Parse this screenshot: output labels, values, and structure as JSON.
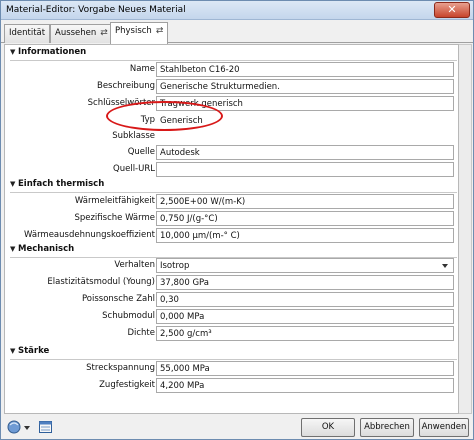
{
  "window": {
    "title": "Material-Editor: Vorgabe Neues Material",
    "close_label": "✕"
  },
  "tabs": [
    {
      "label": "Identität"
    },
    {
      "label": "Aussehen",
      "swap_icon": "⇄"
    },
    {
      "label": "Physisch",
      "swap_icon": "⇄"
    }
  ],
  "sections": {
    "informationen": {
      "title": "Informationen",
      "fields": [
        {
          "label": "Name",
          "value": "Stahlbeton C16-20"
        },
        {
          "label": "Beschreibung",
          "value": "Generische Strukturmedien."
        },
        {
          "label": "Schlüsselwörter",
          "value": "Tragwerk generisch"
        },
        {
          "label": "Typ",
          "value": "Generisch"
        },
        {
          "label": "Subklasse",
          "value": ""
        },
        {
          "label": "Quelle",
          "value": "Autodesk"
        },
        {
          "label": "Quell-URL",
          "value": ""
        }
      ]
    },
    "thermisch": {
      "title": "Einfach thermisch",
      "fields": [
        {
          "label": "Wärmeleitfähigkeit",
          "value": "2,500E+00 W/(m-K)"
        },
        {
          "label": "Spezifische Wärme",
          "value": "0,750 J/(g-°C)"
        },
        {
          "label": "Wärmeausdehnungskoeffizient",
          "value": "10,000 µm/(m-° C)"
        }
      ]
    },
    "mechanisch": {
      "title": "Mechanisch",
      "fields": [
        {
          "label": "Verhalten",
          "value": "Isotrop"
        },
        {
          "label": "Elastizitätsmodul (Young)",
          "value": "37,800 GPa"
        },
        {
          "label": "Poissonsche Zahl",
          "value": "0,30"
        },
        {
          "label": "Schubmodul",
          "value": "0,000 MPa"
        },
        {
          "label": "Dichte",
          "value": "2,500 g/cm³"
        }
      ]
    },
    "staerke": {
      "title": "Stärke",
      "fields": [
        {
          "label": "Streckspannung",
          "value": "55,000 MPa"
        },
        {
          "label": "Zugfestigkeit",
          "value": "4,200 MPa"
        }
      ]
    }
  },
  "buttons": {
    "ok": "OK",
    "cancel": "Abbrechen",
    "apply": "Anwenden"
  },
  "icons": {
    "section_toggle": "triangle-down-icon",
    "material_browser": "material-browser-icon",
    "asset_browser": "asset-browser-icon"
  },
  "colors": {
    "annotation": "#d81818",
    "title_gradient_top": "#dce8f5",
    "close_button": "#c7442c"
  }
}
